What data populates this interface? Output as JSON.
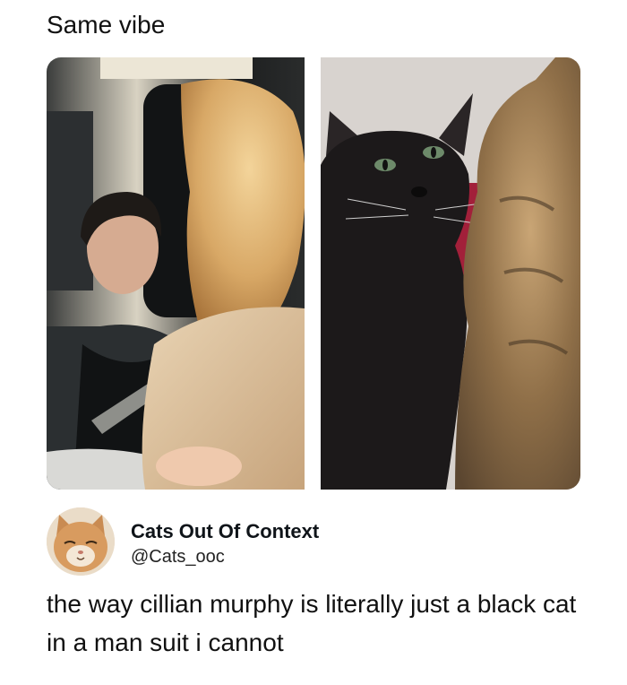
{
  "caption": "Same vibe",
  "tweet": {
    "display_name": "Cats Out Of Context",
    "handle": "@Cats_ooc",
    "text": "the way cillian murphy is literally just a black cat in a man suit i cannot"
  }
}
